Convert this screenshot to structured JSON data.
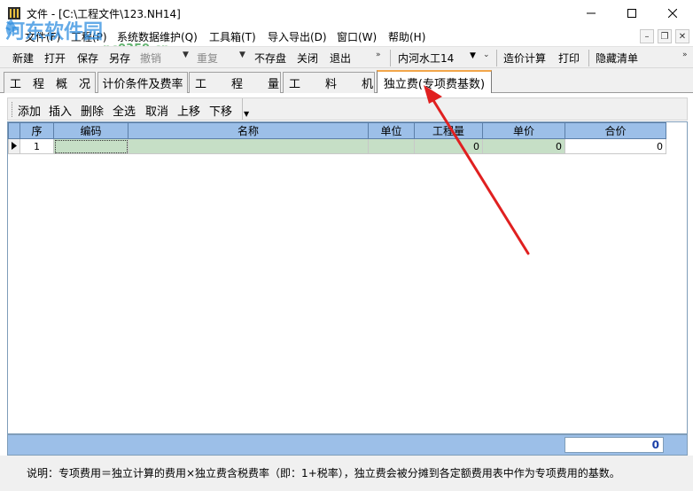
{
  "window": {
    "title": "文件 - [C:\\工程文件\\123.NH14]"
  },
  "watermark": {
    "text": "河东软件园",
    "url": "pc0359.cn"
  },
  "menu": {
    "items": [
      "文件(F)",
      "工程(P)",
      "系统数据维护(Q)",
      "工具箱(T)",
      "导入导出(D)",
      "窗口(W)",
      "帮助(H)"
    ]
  },
  "toolbar": {
    "new": "新建",
    "open": "打开",
    "save": "保存",
    "save_as": "另存",
    "undo": "撤销",
    "redo": "重复",
    "no_save": "不存盘",
    "close": "关闭",
    "exit": "退出",
    "project_type": "内河水工14",
    "calc": "造价计算",
    "print": "打印",
    "hide_list": "隐藏清单"
  },
  "tabs": [
    {
      "label": "工程概况"
    },
    {
      "label": "计价条件及费率"
    },
    {
      "label": "工程量"
    },
    {
      "label": "工料机"
    },
    {
      "label": "独立费(专项费基数)"
    }
  ],
  "grid_toolbar": {
    "add": "添加",
    "insert": "插入",
    "delete": "删除",
    "select_all": "全选",
    "cancel": "取消",
    "move_up": "上移",
    "move_down": "下移"
  },
  "grid": {
    "columns": [
      "序",
      "编码",
      "名称",
      "单位",
      "工程量",
      "单价",
      "合价"
    ],
    "rows": [
      {
        "seq": "1",
        "code": "",
        "name": "",
        "unit": "",
        "qty": "0",
        "price": "0",
        "total": "0"
      }
    ]
  },
  "footer": {
    "total": "0"
  },
  "note": "说明：专项费用＝独立计算的费用×独立费含税费率（即：1+税率），独立费会被分摊到各定额费用表中作为专项费用的基数。",
  "colors": {
    "header_blue": "#9cbfe8",
    "editable_green": "#c6dfc6",
    "active_tab_accent": "#f2a64a",
    "annotation_arrow": "#e02020"
  }
}
